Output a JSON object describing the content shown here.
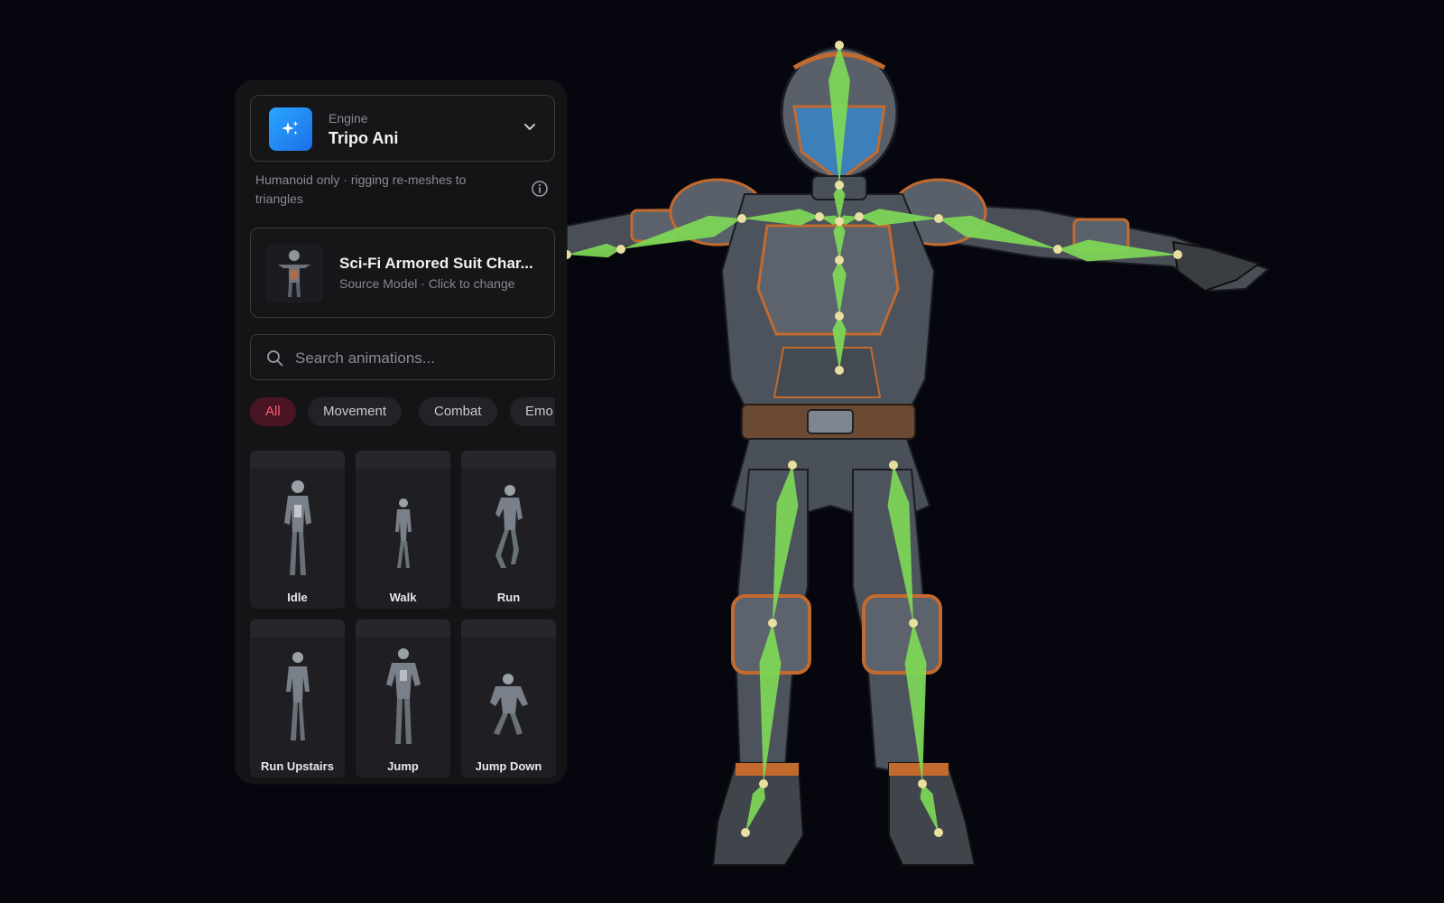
{
  "engine": {
    "caption": "Engine",
    "name": "Tripo Ani",
    "icon": "sparkle-icon",
    "accent": "#1e88ff"
  },
  "hint": {
    "text": "Humanoid only · rigging re-meshes to triangles",
    "icon": "info-icon"
  },
  "source_model": {
    "title": "Sci-Fi Armored Suit Char...",
    "subtitle": "Source Model · Click to change"
  },
  "search": {
    "placeholder": "Search animations..."
  },
  "filters": {
    "active_color": "#ff5c7a",
    "chips": [
      {
        "label": "All",
        "active": true
      },
      {
        "label": "Movement",
        "active": false
      },
      {
        "label": "Combat",
        "active": false
      },
      {
        "label": "Emo",
        "active": false
      }
    ]
  },
  "animations": [
    {
      "label": "Idle"
    },
    {
      "label": "Walk"
    },
    {
      "label": "Run"
    },
    {
      "label": "Run Upstairs"
    },
    {
      "label": "Jump"
    },
    {
      "label": "Jump Down"
    }
  ],
  "viewport": {
    "skeleton_color": "#7ed957",
    "joint_color": "#e8dfa0"
  }
}
